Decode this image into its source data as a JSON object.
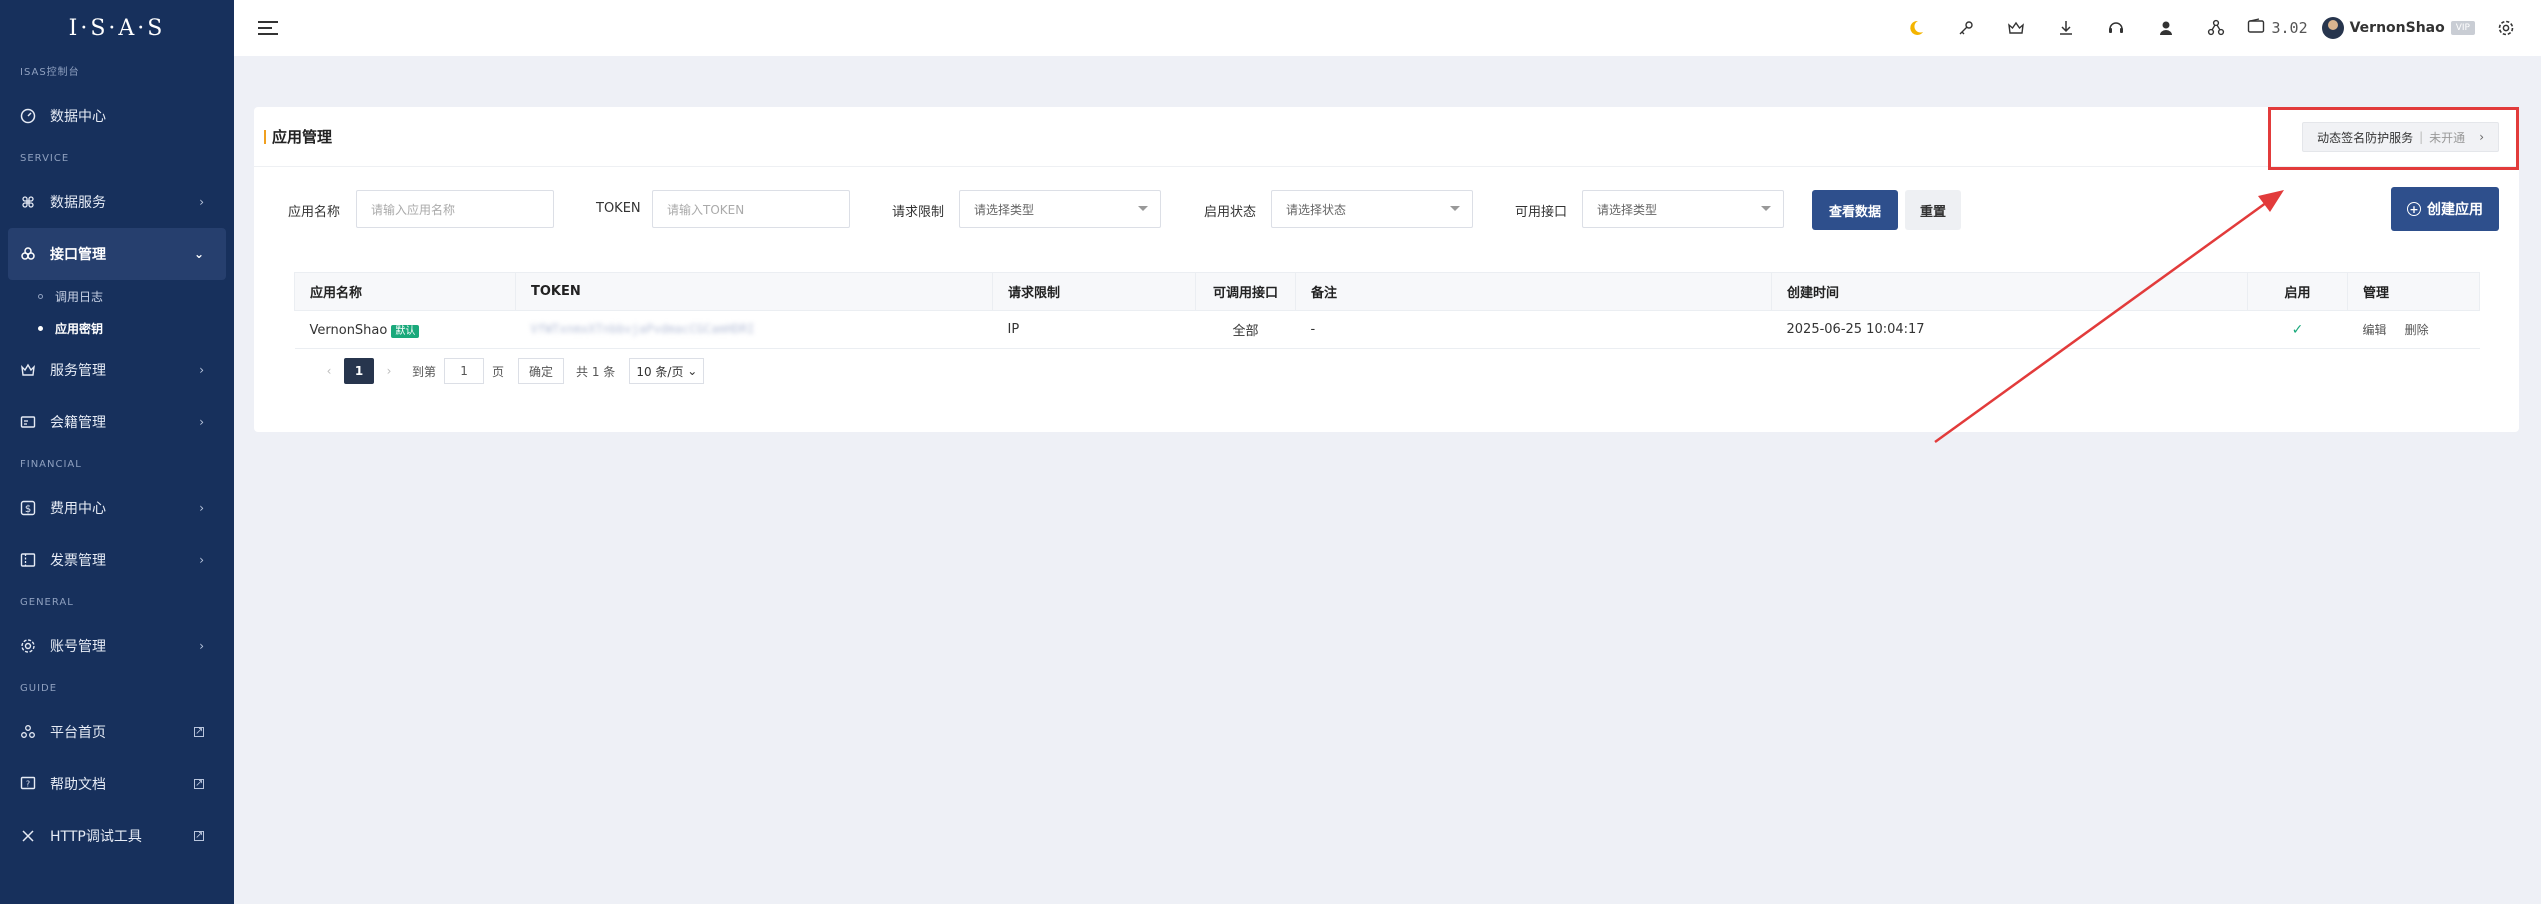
{
  "brand": "I·S·A·S",
  "sidebar": {
    "sections": {
      "console": "ISAS控制台",
      "service": "SERVICE",
      "financial": "FINANCIAL",
      "general": "GENERAL",
      "guide": "GUIDE"
    },
    "items": {
      "data_center": "数据中心",
      "data_service": "数据服务",
      "api_mgmt": "接口管理",
      "call_log": "调用日志",
      "app_key": "应用密钥",
      "service_mgmt": "服务管理",
      "membership": "会籍管理",
      "fee_center": "费用中心",
      "invoice": "发票管理",
      "account": "账号管理",
      "platform_home": "平台首页",
      "help_docs": "帮助文档",
      "http_tool": "HTTP调试工具"
    }
  },
  "header": {
    "balance": "3.02",
    "username": "VernonShao",
    "vip": "VIP"
  },
  "card": {
    "title": "应用管理",
    "dynamic_sign": "动态签名防护服务",
    "dynamic_sign_sep": "|",
    "dynamic_sign_status": "未开通",
    "dynamic_sign_arrow": "›"
  },
  "filters": {
    "app_name_label": "应用名称",
    "app_name_placeholder": "请输入应用名称",
    "token_label": "TOKEN",
    "token_placeholder": "请输入TOKEN",
    "req_limit_label": "请求限制",
    "req_limit_placeholder": "请选择类型",
    "status_label": "启用状态",
    "status_placeholder": "请选择状态",
    "api_label": "可用接口",
    "api_placeholder": "请选择类型",
    "query_btn": "查看数据",
    "reset_btn": "重置",
    "create_btn": "创建应用"
  },
  "table": {
    "headers": [
      "应用名称",
      "TOKEN",
      "请求限制",
      "可调用接口",
      "备注",
      "创建时间",
      "启用",
      "管理"
    ],
    "rows": [
      {
        "name": "VernonShao",
        "tag": "默认",
        "token": "VfWTxnmxXTnbbvjaPvdmacCGCamHDRI",
        "limit": "IP",
        "apis": "全部",
        "note": "-",
        "created": "2025-06-25 10:04:17",
        "enabled": "✓",
        "edit": "编辑",
        "delete": "删除"
      }
    ]
  },
  "pager": {
    "current": "1",
    "goto": "到第",
    "goto_value": "1",
    "page": "页",
    "confirm": "确定",
    "total": "共 1 条",
    "size": "10 条/页"
  },
  "colors": {
    "sidebar": "#17305c",
    "primary": "#2e4f8c",
    "highlight": "#e23b3b",
    "success": "#1aa97b"
  }
}
